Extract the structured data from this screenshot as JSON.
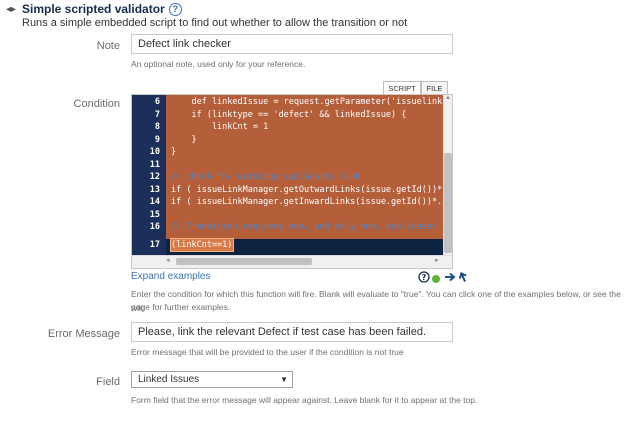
{
  "header": {
    "title": "Simple scripted validator",
    "subtitle": "Runs a simple embedded script to find out whether to allow the transition or not"
  },
  "note": {
    "label": "Note",
    "value": "Defect link checker",
    "help": "An optional note, used only for your reference."
  },
  "condition": {
    "label": "Condition",
    "tabs": [
      "SCRIPT",
      "FILE"
    ],
    "active_tab": "SCRIPT",
    "code_lines": [
      {
        "n": "6",
        "text": "    def linkedIssue = request.getParameter('issuelinks-"
      },
      {
        "n": "7",
        "text": "    if (linktype == 'defect' && linkedIssue) {"
      },
      {
        "n": "8",
        "text": "        linkCnt = 1"
      },
      {
        "n": "9",
        "text": "    }"
      },
      {
        "n": "10",
        "text": "}"
      },
      {
        "n": "11",
        "text": ""
      },
      {
        "n": "12",
        "text": "// check for existing duplicates link"
      },
      {
        "n": "13",
        "text": "if ( issueLinkManager.getOutwardLinks(issue.getId())*.i"
      },
      {
        "n": "14",
        "text": "if ( issueLinkManager.getInwardLinks(issue.getId())*.is"
      },
      {
        "n": "15",
        "text": ""
      },
      {
        "n": "16",
        "text": "// Transition requires one, and only one, duplicates li"
      },
      {
        "n": "17",
        "text": "(linkCnt==1)"
      }
    ],
    "expand_examples": "Expand examples",
    "help_line1": "Enter the condition for which this function will fire. Blank will evaluate to \"true\". You can click one of the examples below, or see the wiki",
    "help_line2": "page for further examples."
  },
  "error_message": {
    "label": "Error Message",
    "value": "Please, link the relevant Defect if test case has been failed.",
    "help": "Error message that will be provided to the user if the condition is not true"
  },
  "field": {
    "label": "Field",
    "selected": "Linked Issues",
    "help": "Form field that the error message will appear against. Leave blank for it to appear at the top."
  },
  "colors": {
    "code_background": "#b55f3a",
    "gutter": "#1c2f5a",
    "link": "#3b73af"
  }
}
